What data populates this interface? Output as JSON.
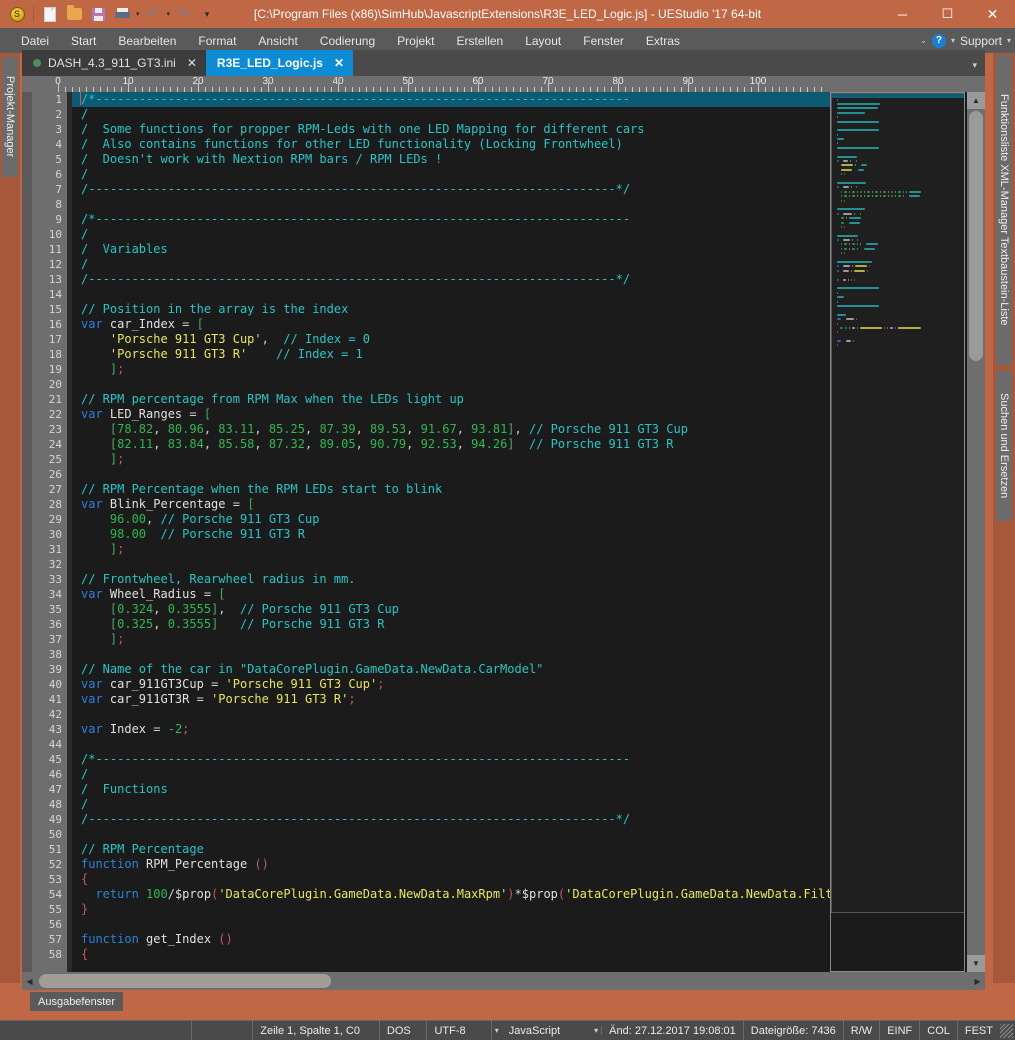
{
  "window": {
    "title": "[C:\\Program Files (x86)\\SimHub\\JavascriptExtensions\\R3E_LED_Logic.js] - UEStudio '17 64-bit",
    "minimize": "─",
    "maximize": "☐",
    "close": "✕"
  },
  "toolbar": {
    "icons": [
      "app-logo-coin",
      "new-file",
      "open-folder",
      "save",
      "print",
      "undo",
      "redo",
      "customize"
    ],
    "coin_glyph": "S"
  },
  "menubar": {
    "items": [
      "Datei",
      "Start",
      "Bearbeiten",
      "Format",
      "Ansicht",
      "Codierung",
      "Projekt",
      "Erstellen",
      "Layout",
      "Fenster",
      "Extras"
    ],
    "support_label": "Support",
    "help_glyph": "?",
    "chevron": "⌄",
    "caret": "▾"
  },
  "left_dock": {
    "tabs": [
      "Projekt-Manager"
    ]
  },
  "right_dock": {
    "group1": "Funktionsliste  XML-Manager  Textbaustein-Liste",
    "group2": "Suchen und Ersetzen"
  },
  "tabs": [
    {
      "label": "DASH_4.3_911_GT3.ini",
      "active": false,
      "close": "✕",
      "modified_dot": true
    },
    {
      "label": "R3E_LED_Logic.js",
      "active": true,
      "close": "✕",
      "modified_dot": false
    }
  ],
  "ruler": {
    "numbers": [
      "0",
      "10",
      "20",
      "30",
      "40",
      "50",
      "60",
      "70",
      "80",
      "90",
      "100"
    ]
  },
  "editor": {
    "first_line": 1,
    "total_visible_lines": 58,
    "lines": [
      {
        "n": 1,
        "tokens": [
          [
            "cm",
            "/*--------------------------------------------------------------------------"
          ]
        ],
        "selected": true
      },
      {
        "n": 2,
        "tokens": [
          [
            "cm",
            "/"
          ]
        ]
      },
      {
        "n": 3,
        "tokens": [
          [
            "cm",
            "/  Some functions for propper RPM-Leds with one LED Mapping for different cars"
          ]
        ]
      },
      {
        "n": 4,
        "tokens": [
          [
            "cm",
            "/  Also contains functions for other LED functionality (Locking Frontwheel)"
          ]
        ]
      },
      {
        "n": 5,
        "tokens": [
          [
            "cm",
            "/  Doesn't work with Nextion RPM bars / RPM LEDs !"
          ]
        ]
      },
      {
        "n": 6,
        "tokens": [
          [
            "cm",
            "/"
          ]
        ]
      },
      {
        "n": 7,
        "tokens": [
          [
            "cm",
            "/-------------------------------------------------------------------------*/"
          ]
        ]
      },
      {
        "n": 8,
        "tokens": []
      },
      {
        "n": 9,
        "tokens": [
          [
            "cm",
            "/*--------------------------------------------------------------------------"
          ]
        ]
      },
      {
        "n": 10,
        "tokens": [
          [
            "cm",
            "/"
          ]
        ]
      },
      {
        "n": 11,
        "tokens": [
          [
            "cm",
            "/  Variables"
          ]
        ]
      },
      {
        "n": 12,
        "tokens": [
          [
            "cm",
            "/"
          ]
        ]
      },
      {
        "n": 13,
        "tokens": [
          [
            "cm",
            "/-------------------------------------------------------------------------*/"
          ]
        ]
      },
      {
        "n": 14,
        "tokens": []
      },
      {
        "n": 15,
        "tokens": [
          [
            "cm",
            "// Position in the array is the index"
          ]
        ]
      },
      {
        "n": 16,
        "tokens": [
          [
            "kw",
            "var"
          ],
          [
            "id",
            " car_Index "
          ],
          [
            "op",
            "="
          ],
          [
            "br",
            " ["
          ]
        ]
      },
      {
        "n": 17,
        "tokens": [
          [
            "id",
            "    "
          ],
          [
            "str",
            "'Porsche 911 GT3 Cup'"
          ],
          [
            "op",
            ","
          ],
          [
            "cm",
            "  // Index = 0"
          ]
        ]
      },
      {
        "n": 18,
        "tokens": [
          [
            "id",
            "    "
          ],
          [
            "str",
            "'Porsche 911 GT3 R'"
          ],
          [
            "cm",
            "    // Index = 1"
          ]
        ]
      },
      {
        "n": 19,
        "tokens": [
          [
            "br",
            "    ]"
          ],
          [
            "pn",
            ";"
          ]
        ]
      },
      {
        "n": 20,
        "tokens": []
      },
      {
        "n": 21,
        "tokens": [
          [
            "cm",
            "// RPM percentage from RPM Max when the LEDs light up"
          ]
        ]
      },
      {
        "n": 22,
        "tokens": [
          [
            "kw",
            "var"
          ],
          [
            "id",
            " LED_Ranges "
          ],
          [
            "op",
            "="
          ],
          [
            "br",
            " ["
          ]
        ]
      },
      {
        "n": 23,
        "tokens": [
          [
            "br",
            "    ["
          ],
          [
            "num",
            "78.82"
          ],
          [
            "op",
            ", "
          ],
          [
            "num",
            "80.96"
          ],
          [
            "op",
            ", "
          ],
          [
            "num",
            "83.11"
          ],
          [
            "op",
            ", "
          ],
          [
            "num",
            "85.25"
          ],
          [
            "op",
            ", "
          ],
          [
            "num",
            "87.39"
          ],
          [
            "op",
            ", "
          ],
          [
            "num",
            "89.53"
          ],
          [
            "op",
            ", "
          ],
          [
            "num",
            "91.67"
          ],
          [
            "op",
            ", "
          ],
          [
            "num",
            "93.81"
          ],
          [
            "br",
            "]"
          ],
          [
            "op",
            ", "
          ],
          [
            "cm",
            "// Porsche 911 GT3 Cup"
          ]
        ]
      },
      {
        "n": 24,
        "tokens": [
          [
            "br",
            "    ["
          ],
          [
            "num",
            "82.11"
          ],
          [
            "op",
            ", "
          ],
          [
            "num",
            "83.84"
          ],
          [
            "op",
            ", "
          ],
          [
            "num",
            "85.58"
          ],
          [
            "op",
            ", "
          ],
          [
            "num",
            "87.32"
          ],
          [
            "op",
            ", "
          ],
          [
            "num",
            "89.05"
          ],
          [
            "op",
            ", "
          ],
          [
            "num",
            "90.79"
          ],
          [
            "op",
            ", "
          ],
          [
            "num",
            "92.53"
          ],
          [
            "op",
            ", "
          ],
          [
            "num",
            "94.26"
          ],
          [
            "br",
            "]"
          ],
          [
            "cm",
            "  // Porsche 911 GT3 R"
          ]
        ]
      },
      {
        "n": 25,
        "tokens": [
          [
            "br",
            "    ]"
          ],
          [
            "pn",
            ";"
          ]
        ]
      },
      {
        "n": 26,
        "tokens": []
      },
      {
        "n": 27,
        "tokens": [
          [
            "cm",
            "// RPM Percentage when the RPM LEDs start to blink"
          ]
        ]
      },
      {
        "n": 28,
        "tokens": [
          [
            "kw",
            "var"
          ],
          [
            "id",
            " Blink_Percentage "
          ],
          [
            "op",
            "="
          ],
          [
            "br",
            " ["
          ]
        ]
      },
      {
        "n": 29,
        "tokens": [
          [
            "num",
            "    96.00"
          ],
          [
            "op",
            ", "
          ],
          [
            "cm",
            "// Porsche 911 GT3 Cup"
          ]
        ]
      },
      {
        "n": 30,
        "tokens": [
          [
            "num",
            "    98.00"
          ],
          [
            "cm",
            "  // Porsche 911 GT3 R"
          ]
        ]
      },
      {
        "n": 31,
        "tokens": [
          [
            "br",
            "    ]"
          ],
          [
            "pn",
            ";"
          ]
        ]
      },
      {
        "n": 32,
        "tokens": []
      },
      {
        "n": 33,
        "tokens": [
          [
            "cm",
            "// Frontwheel, Rearwheel radius in mm."
          ]
        ]
      },
      {
        "n": 34,
        "tokens": [
          [
            "kw",
            "var"
          ],
          [
            "id",
            " Wheel_Radius "
          ],
          [
            "op",
            "="
          ],
          [
            "br",
            " ["
          ]
        ]
      },
      {
        "n": 35,
        "tokens": [
          [
            "br",
            "    ["
          ],
          [
            "num",
            "0.324"
          ],
          [
            "op",
            ", "
          ],
          [
            "num",
            "0.3555"
          ],
          [
            "br",
            "]"
          ],
          [
            "op",
            ", "
          ],
          [
            "cm",
            " // Porsche 911 GT3 Cup"
          ]
        ]
      },
      {
        "n": 36,
        "tokens": [
          [
            "br",
            "    ["
          ],
          [
            "num",
            "0.325"
          ],
          [
            "op",
            ", "
          ],
          [
            "num",
            "0.3555"
          ],
          [
            "br",
            "]"
          ],
          [
            "cm",
            "   // Porsche 911 GT3 R"
          ]
        ]
      },
      {
        "n": 37,
        "tokens": [
          [
            "br",
            "    ]"
          ],
          [
            "pn",
            ";"
          ]
        ]
      },
      {
        "n": 38,
        "tokens": []
      },
      {
        "n": 39,
        "tokens": [
          [
            "cm",
            "// Name of the car in \"DataCorePlugin.GameData.NewData.CarModel\""
          ]
        ]
      },
      {
        "n": 40,
        "tokens": [
          [
            "kw",
            "var"
          ],
          [
            "id",
            " car_911GT3Cup "
          ],
          [
            "op",
            "= "
          ],
          [
            "str",
            "'Porsche 911 GT3 Cup'"
          ],
          [
            "pn",
            ";"
          ]
        ]
      },
      {
        "n": 41,
        "tokens": [
          [
            "kw",
            "var"
          ],
          [
            "id",
            " car_911GT3R "
          ],
          [
            "op",
            "= "
          ],
          [
            "str",
            "'Porsche 911 GT3 R'"
          ],
          [
            "pn",
            ";"
          ]
        ]
      },
      {
        "n": 42,
        "tokens": []
      },
      {
        "n": 43,
        "tokens": [
          [
            "kw",
            "var"
          ],
          [
            "id",
            " Index "
          ],
          [
            "op",
            "= "
          ],
          [
            "num",
            "-2"
          ],
          [
            "pn",
            ";"
          ]
        ]
      },
      {
        "n": 44,
        "tokens": []
      },
      {
        "n": 45,
        "tokens": [
          [
            "cm",
            "/*--------------------------------------------------------------------------"
          ]
        ]
      },
      {
        "n": 46,
        "tokens": [
          [
            "cm",
            "/"
          ]
        ]
      },
      {
        "n": 47,
        "tokens": [
          [
            "cm",
            "/  Functions"
          ]
        ]
      },
      {
        "n": 48,
        "tokens": [
          [
            "cm",
            "/"
          ]
        ]
      },
      {
        "n": 49,
        "tokens": [
          [
            "cm",
            "/-------------------------------------------------------------------------*/"
          ]
        ]
      },
      {
        "n": 50,
        "tokens": []
      },
      {
        "n": 51,
        "tokens": [
          [
            "cm",
            "// RPM Percentage"
          ]
        ]
      },
      {
        "n": 52,
        "tokens": [
          [
            "kw",
            "function"
          ],
          [
            "fn",
            " RPM_Percentage "
          ],
          [
            "pn",
            "()"
          ]
        ]
      },
      {
        "n": 53,
        "tokens": [
          [
            "pn",
            "{"
          ]
        ]
      },
      {
        "n": 54,
        "tokens": [
          [
            "kw",
            "  return "
          ],
          [
            "num",
            "100"
          ],
          [
            "op",
            "/"
          ],
          [
            "fn",
            "$prop"
          ],
          [
            "pn",
            "("
          ],
          [
            "str",
            "'DataCorePlugin.GameData.NewData.MaxRpm'"
          ],
          [
            "pn",
            ")"
          ],
          [
            "op",
            "*"
          ],
          [
            "fn",
            "$prop"
          ],
          [
            "pn",
            "("
          ],
          [
            "str",
            "'DataCorePlugin.GameData.NewData.FilteredR"
          ]
        ]
      },
      {
        "n": 55,
        "tokens": [
          [
            "pn",
            "}"
          ]
        ]
      },
      {
        "n": 56,
        "tokens": []
      },
      {
        "n": 57,
        "tokens": [
          [
            "kw",
            "function"
          ],
          [
            "fn",
            " get_Index "
          ],
          [
            "pn",
            "()"
          ]
        ]
      },
      {
        "n": 58,
        "tokens": [
          [
            "pn",
            "{"
          ]
        ]
      }
    ]
  },
  "scrollbars": {
    "v_up": "▲",
    "v_down": "▼",
    "h_left": "◀",
    "h_right": "▶"
  },
  "output": {
    "tab_label": "Ausgabefenster"
  },
  "statusbar": {
    "cursor": "Zeile 1, Spalte 1, C0",
    "line_ending": "DOS",
    "encoding": "UTF-8",
    "language": "JavaScript",
    "modified": "Änd: 27.12.2017 19:08:01",
    "filesize": "Dateigröße: 7436",
    "rw": "R/W",
    "insert": "EINF",
    "col": "COL",
    "fest": "FEST",
    "caret": "▾"
  },
  "colors": {
    "titlebar": "#c06845",
    "menubar": "#5a5a5a",
    "active_tab": "#0d8bd4",
    "editor_bg": "#1b1b1b",
    "comment": "#26c6c6",
    "keyword": "#2f7fd8",
    "string": "#e8e85a",
    "number": "#2fb84f",
    "selection": "#0d5a75"
  }
}
